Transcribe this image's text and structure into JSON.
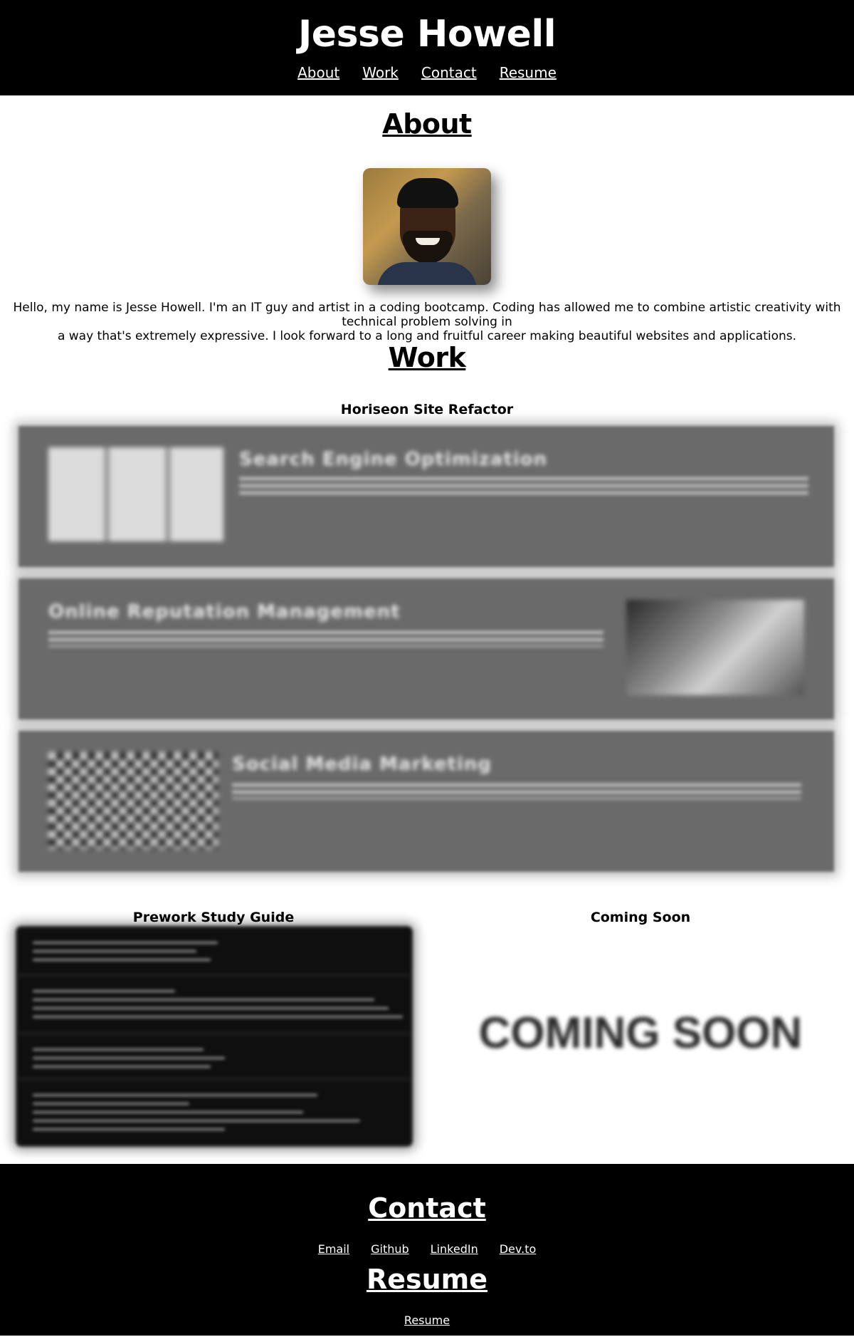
{
  "header": {
    "title": "Jesse Howell",
    "nav": [
      "About",
      "Work",
      "Contact",
      "Resume"
    ]
  },
  "about": {
    "heading": "About",
    "text_line1": "Hello, my name is Jesse Howell. I'm an IT guy and artist in a coding bootcamp. Coding has allowed me to combine artistic creativity with technical problem solving in",
    "text_line2": "a way that's extremely expressive. I look forward to a long and fruitful career making beautiful websites and applications."
  },
  "work": {
    "heading": "Work",
    "projects": [
      {
        "title": "Horiseon Site Refactor",
        "cards": [
          {
            "heading": "Search Engine Optimization"
          },
          {
            "heading": "Online Reputation Management"
          },
          {
            "heading": "Social Media Marketing"
          }
        ]
      },
      {
        "title": "Prework Study Guide"
      },
      {
        "title": "Coming Soon",
        "art_text": "COMING SOON"
      }
    ]
  },
  "contact": {
    "heading": "Contact",
    "links": [
      "Email",
      "Github",
      "LinkedIn",
      "Dev.to"
    ]
  },
  "resume": {
    "heading": "Resume",
    "link": "Resume"
  },
  "colors": {
    "header_bg": "#000000",
    "card_bg": "#6a6a6a",
    "page_bg": "#ffffff"
  }
}
